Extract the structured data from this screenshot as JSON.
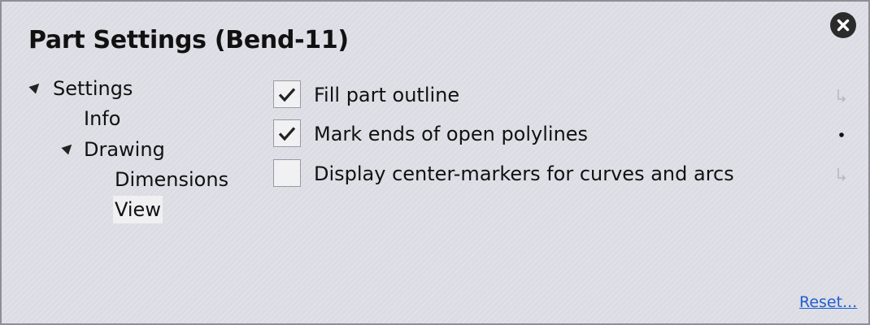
{
  "dialog": {
    "title": "Part Settings (Bend-11)"
  },
  "tree": {
    "settings": "Settings",
    "info": "Info",
    "drawing": "Drawing",
    "dimensions": "Dimensions",
    "view": "View",
    "selected": "View"
  },
  "options": [
    {
      "label": "Fill part outline",
      "checked": true,
      "indicator": "inherit-arrow-icon"
    },
    {
      "label": "Mark ends of open polylines",
      "checked": true,
      "indicator": "modified-dot-icon"
    },
    {
      "label": "Display center-markers for curves and arcs",
      "checked": false,
      "indicator": "inherit-arrow-icon"
    }
  ],
  "footer": {
    "reset_label": "Reset..."
  },
  "colors": {
    "background": "#dcdce4",
    "link": "#1f5fcf",
    "close_button": "#2b2b2b"
  },
  "icons": {
    "close": "close-icon",
    "expander": "expander-triangle-icon",
    "check": "checkmark-icon"
  }
}
